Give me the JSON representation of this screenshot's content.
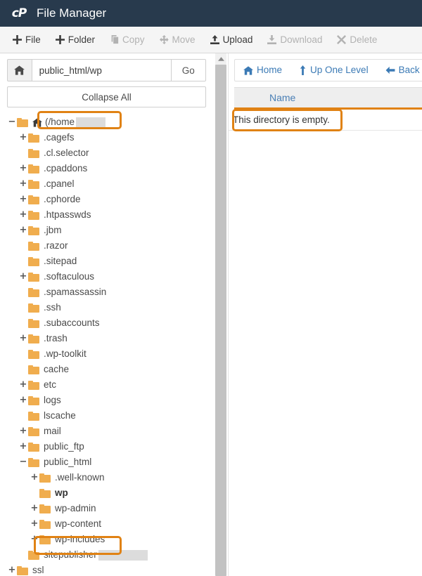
{
  "app": {
    "logo": "cp-logo",
    "title": "File Manager"
  },
  "toolbar": {
    "items": [
      {
        "label": "File",
        "icon": "plus-icon",
        "disabled": false
      },
      {
        "label": "Folder",
        "icon": "plus-icon",
        "disabled": false
      },
      {
        "label": "Copy",
        "icon": "copy-icon",
        "disabled": true
      },
      {
        "label": "Move",
        "icon": "move-icon",
        "disabled": true
      },
      {
        "label": "Upload",
        "icon": "upload-icon",
        "disabled": false
      },
      {
        "label": "Download",
        "icon": "download-icon",
        "disabled": true
      },
      {
        "label": "Delete",
        "icon": "delete-x-icon",
        "disabled": true
      }
    ]
  },
  "pathbar": {
    "home_icon": "home-icon",
    "value": "public_html/wp",
    "placeholder": "",
    "go_label": "Go",
    "collapse_label": "Collapse All"
  },
  "filelist": {
    "nav": [
      {
        "label": "Home",
        "icon": "home-icon"
      },
      {
        "label": "Up One Level",
        "icon": "up-arrow-icon"
      },
      {
        "label": "Back",
        "icon": "left-arrow-icon"
      }
    ],
    "column_header": "Name",
    "empty_message": "This directory is empty."
  },
  "tree": {
    "nodes": [
      {
        "label": "(/home",
        "indent": 0,
        "twig": "−",
        "open": true,
        "home": true,
        "redact": 42
      },
      {
        "label": ".cagefs",
        "indent": 1,
        "twig": "+",
        "open": false
      },
      {
        "label": ".cl.selector",
        "indent": 1,
        "twig": "",
        "open": false
      },
      {
        "label": ".cpaddons",
        "indent": 1,
        "twig": "+",
        "open": false
      },
      {
        "label": ".cpanel",
        "indent": 1,
        "twig": "+",
        "open": false
      },
      {
        "label": ".cphorde",
        "indent": 1,
        "twig": "+",
        "open": false
      },
      {
        "label": ".htpasswds",
        "indent": 1,
        "twig": "+",
        "open": false
      },
      {
        "label": ".jbm",
        "indent": 1,
        "twig": "+",
        "open": false
      },
      {
        "label": ".razor",
        "indent": 1,
        "twig": "",
        "open": false
      },
      {
        "label": ".sitepad",
        "indent": 1,
        "twig": "",
        "open": false
      },
      {
        "label": ".softaculous",
        "indent": 1,
        "twig": "+",
        "open": false
      },
      {
        "label": ".spamassassin",
        "indent": 1,
        "twig": "",
        "open": false
      },
      {
        "label": ".ssh",
        "indent": 1,
        "twig": "",
        "open": false
      },
      {
        "label": ".subaccounts",
        "indent": 1,
        "twig": "",
        "open": false
      },
      {
        "label": ".trash",
        "indent": 1,
        "twig": "+",
        "open": false
      },
      {
        "label": ".wp-toolkit",
        "indent": 1,
        "twig": "",
        "open": false
      },
      {
        "label": "cache",
        "indent": 1,
        "twig": "",
        "open": false
      },
      {
        "label": "etc",
        "indent": 1,
        "twig": "+",
        "open": false
      },
      {
        "label": "logs",
        "indent": 1,
        "twig": "+",
        "open": false
      },
      {
        "label": "lscache",
        "indent": 1,
        "twig": "",
        "open": false
      },
      {
        "label": "mail",
        "indent": 1,
        "twig": "+",
        "open": false
      },
      {
        "label": "public_ftp",
        "indent": 1,
        "twig": "+",
        "open": false
      },
      {
        "label": "public_html",
        "indent": 1,
        "twig": "−",
        "open": true
      },
      {
        "label": ".well-known",
        "indent": 2,
        "twig": "+",
        "open": false
      },
      {
        "label": "wp",
        "indent": 2,
        "twig": "",
        "open": false,
        "selected": true
      },
      {
        "label": "wp-admin",
        "indent": 2,
        "twig": "+",
        "open": false
      },
      {
        "label": "wp-content",
        "indent": 2,
        "twig": "+",
        "open": false
      },
      {
        "label": "wp-includes",
        "indent": 2,
        "twig": "+",
        "open": false
      },
      {
        "label": "sitepublisher",
        "indent": 1,
        "twig": "",
        "open": false,
        "redact": 70
      },
      {
        "label": "ssl",
        "indent": 0,
        "twig": "+",
        "open": false
      }
    ]
  },
  "annotations": {
    "color": "#e08214",
    "targets": [
      "path-input",
      "empty-message",
      "tree-node-wp"
    ]
  }
}
